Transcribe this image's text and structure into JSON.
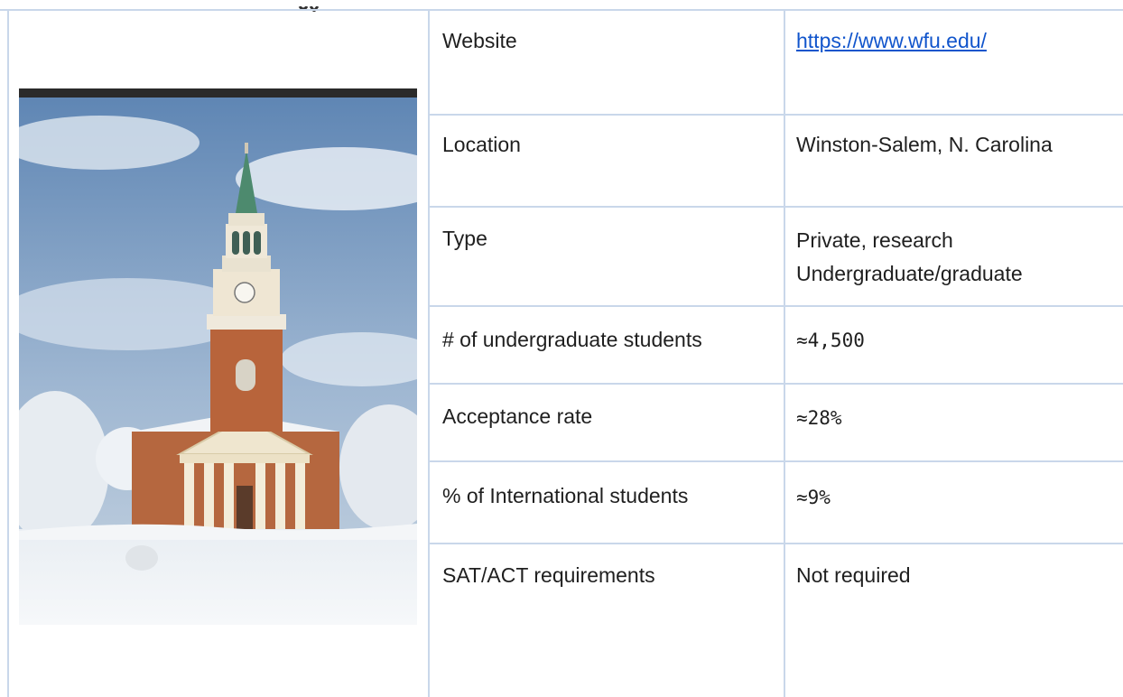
{
  "table": {
    "rows": [
      {
        "label": "Website",
        "value": "https://www.wfu.edu/"
      },
      {
        "label": "Location",
        "value": "Winston-Salem, N. Carolina"
      },
      {
        "label": "Type",
        "value_line1": "Private, research",
        "value_line2": "Undergraduate/graduate"
      },
      {
        "label": "# of undergraduate students",
        "value": "≈4,500"
      },
      {
        "label": "Acceptance rate",
        "value": "≈28%"
      },
      {
        "label": "% of International students",
        "value": "≈9%"
      },
      {
        "label": "SAT/ACT requirements",
        "value": "Not required"
      }
    ]
  },
  "colors": {
    "grid": "#c9d7ea",
    "link": "#1155cc",
    "text": "#1f1f1f"
  },
  "image": {
    "subject": "campus-chapel-in-snow"
  }
}
